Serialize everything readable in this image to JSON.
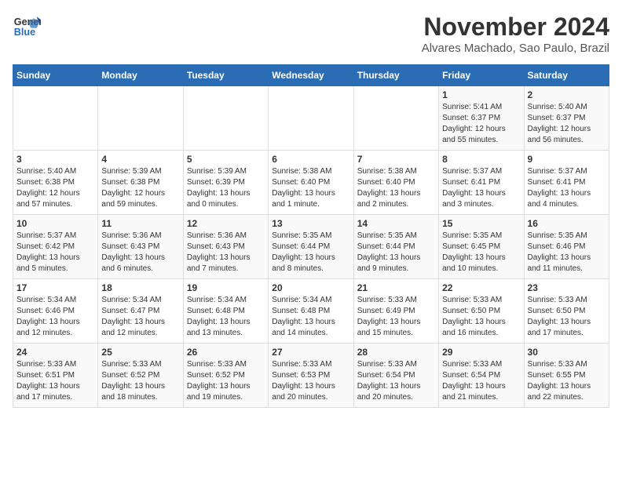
{
  "header": {
    "logo_line1": "General",
    "logo_line2": "Blue",
    "month": "November 2024",
    "location": "Alvares Machado, Sao Paulo, Brazil"
  },
  "days_of_week": [
    "Sunday",
    "Monday",
    "Tuesday",
    "Wednesday",
    "Thursday",
    "Friday",
    "Saturday"
  ],
  "weeks": [
    [
      {
        "day": "",
        "info": ""
      },
      {
        "day": "",
        "info": ""
      },
      {
        "day": "",
        "info": ""
      },
      {
        "day": "",
        "info": ""
      },
      {
        "day": "",
        "info": ""
      },
      {
        "day": "1",
        "info": "Sunrise: 5:41 AM\nSunset: 6:37 PM\nDaylight: 12 hours and 55 minutes."
      },
      {
        "day": "2",
        "info": "Sunrise: 5:40 AM\nSunset: 6:37 PM\nDaylight: 12 hours and 56 minutes."
      }
    ],
    [
      {
        "day": "3",
        "info": "Sunrise: 5:40 AM\nSunset: 6:38 PM\nDaylight: 12 hours and 57 minutes."
      },
      {
        "day": "4",
        "info": "Sunrise: 5:39 AM\nSunset: 6:38 PM\nDaylight: 12 hours and 59 minutes."
      },
      {
        "day": "5",
        "info": "Sunrise: 5:39 AM\nSunset: 6:39 PM\nDaylight: 13 hours and 0 minutes."
      },
      {
        "day": "6",
        "info": "Sunrise: 5:38 AM\nSunset: 6:40 PM\nDaylight: 13 hours and 1 minute."
      },
      {
        "day": "7",
        "info": "Sunrise: 5:38 AM\nSunset: 6:40 PM\nDaylight: 13 hours and 2 minutes."
      },
      {
        "day": "8",
        "info": "Sunrise: 5:37 AM\nSunset: 6:41 PM\nDaylight: 13 hours and 3 minutes."
      },
      {
        "day": "9",
        "info": "Sunrise: 5:37 AM\nSunset: 6:41 PM\nDaylight: 13 hours and 4 minutes."
      }
    ],
    [
      {
        "day": "10",
        "info": "Sunrise: 5:37 AM\nSunset: 6:42 PM\nDaylight: 13 hours and 5 minutes."
      },
      {
        "day": "11",
        "info": "Sunrise: 5:36 AM\nSunset: 6:43 PM\nDaylight: 13 hours and 6 minutes."
      },
      {
        "day": "12",
        "info": "Sunrise: 5:36 AM\nSunset: 6:43 PM\nDaylight: 13 hours and 7 minutes."
      },
      {
        "day": "13",
        "info": "Sunrise: 5:35 AM\nSunset: 6:44 PM\nDaylight: 13 hours and 8 minutes."
      },
      {
        "day": "14",
        "info": "Sunrise: 5:35 AM\nSunset: 6:44 PM\nDaylight: 13 hours and 9 minutes."
      },
      {
        "day": "15",
        "info": "Sunrise: 5:35 AM\nSunset: 6:45 PM\nDaylight: 13 hours and 10 minutes."
      },
      {
        "day": "16",
        "info": "Sunrise: 5:35 AM\nSunset: 6:46 PM\nDaylight: 13 hours and 11 minutes."
      }
    ],
    [
      {
        "day": "17",
        "info": "Sunrise: 5:34 AM\nSunset: 6:46 PM\nDaylight: 13 hours and 12 minutes."
      },
      {
        "day": "18",
        "info": "Sunrise: 5:34 AM\nSunset: 6:47 PM\nDaylight: 13 hours and 12 minutes."
      },
      {
        "day": "19",
        "info": "Sunrise: 5:34 AM\nSunset: 6:48 PM\nDaylight: 13 hours and 13 minutes."
      },
      {
        "day": "20",
        "info": "Sunrise: 5:34 AM\nSunset: 6:48 PM\nDaylight: 13 hours and 14 minutes."
      },
      {
        "day": "21",
        "info": "Sunrise: 5:33 AM\nSunset: 6:49 PM\nDaylight: 13 hours and 15 minutes."
      },
      {
        "day": "22",
        "info": "Sunrise: 5:33 AM\nSunset: 6:50 PM\nDaylight: 13 hours and 16 minutes."
      },
      {
        "day": "23",
        "info": "Sunrise: 5:33 AM\nSunset: 6:50 PM\nDaylight: 13 hours and 17 minutes."
      }
    ],
    [
      {
        "day": "24",
        "info": "Sunrise: 5:33 AM\nSunset: 6:51 PM\nDaylight: 13 hours and 17 minutes."
      },
      {
        "day": "25",
        "info": "Sunrise: 5:33 AM\nSunset: 6:52 PM\nDaylight: 13 hours and 18 minutes."
      },
      {
        "day": "26",
        "info": "Sunrise: 5:33 AM\nSunset: 6:52 PM\nDaylight: 13 hours and 19 minutes."
      },
      {
        "day": "27",
        "info": "Sunrise: 5:33 AM\nSunset: 6:53 PM\nDaylight: 13 hours and 20 minutes."
      },
      {
        "day": "28",
        "info": "Sunrise: 5:33 AM\nSunset: 6:54 PM\nDaylight: 13 hours and 20 minutes."
      },
      {
        "day": "29",
        "info": "Sunrise: 5:33 AM\nSunset: 6:54 PM\nDaylight: 13 hours and 21 minutes."
      },
      {
        "day": "30",
        "info": "Sunrise: 5:33 AM\nSunset: 6:55 PM\nDaylight: 13 hours and 22 minutes."
      }
    ]
  ]
}
